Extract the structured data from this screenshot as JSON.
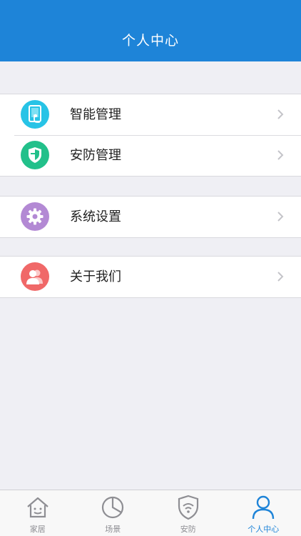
{
  "header": {
    "title": "个人中心"
  },
  "groups": [
    {
      "items": [
        {
          "label": "智能管理",
          "icon": "tablet-touch-icon",
          "color": "#27c3e6"
        },
        {
          "label": "安防管理",
          "icon": "shield-check-icon",
          "color": "#22c08a"
        }
      ]
    },
    {
      "items": [
        {
          "label": "系统设置",
          "icon": "gear-icon",
          "color": "#b389d4"
        }
      ]
    },
    {
      "items": [
        {
          "label": "关于我们",
          "icon": "users-icon",
          "color": "#f06868"
        }
      ]
    }
  ],
  "tabbar": {
    "active_color": "#1e84d8",
    "items": [
      {
        "label": "家居",
        "icon": "home-icon"
      },
      {
        "label": "场景",
        "icon": "pie-chart-icon"
      },
      {
        "label": "安防",
        "icon": "shield-wifi-icon"
      },
      {
        "label": "个人中心",
        "icon": "person-icon",
        "active": true
      }
    ]
  }
}
